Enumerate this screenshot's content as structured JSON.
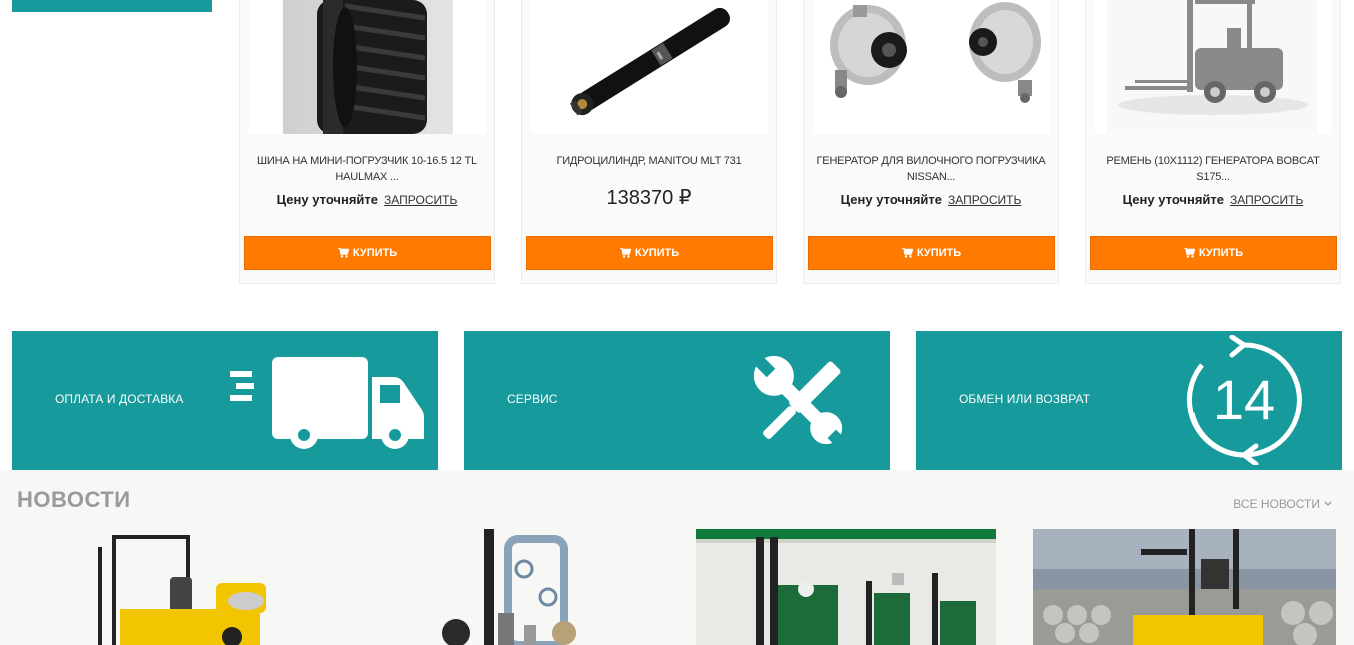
{
  "products": [
    {
      "title": "ШИНА НА МИНИ-ПОГРУЗЧИК 10-16.5 12 TL HAULMAX ...",
      "price_label": "Цену уточняйте",
      "ask_label": "ЗАПРОСИТЬ",
      "buy_label": "КУПИТЬ",
      "image": "tire"
    },
    {
      "title": "ГИДРОЦИЛИНДР, MANITOU MLT 731",
      "price": "138370 ₽",
      "buy_label": "КУПИТЬ",
      "image": "hydraulic-cylinder"
    },
    {
      "title": "ГЕНЕРАТОР ДЛЯ ВИЛОЧНОГО ПОГРУЗЧИКА NISSAN...",
      "price_label": "Цену уточняйте",
      "ask_label": "ЗАПРОСИТЬ",
      "buy_label": "КУПИТЬ",
      "image": "alternators"
    },
    {
      "title": "РЕМЕНЬ (10X1112) ГЕНЕРАТОРА BOBCAT S175...",
      "price_label": "Цену уточняйте",
      "ask_label": "ЗАПРОСИТЬ",
      "buy_label": "КУПИТЬ",
      "image": "forklift-placeholder"
    }
  ],
  "banners": [
    {
      "label": "ОПЛАТА И ДОСТАВКА",
      "icon": "truck-icon"
    },
    {
      "label": "СЕРВИС",
      "icon": "tools-icon"
    },
    {
      "label": "ОБМЕН ИЛИ ВОЗВРАТ",
      "icon": "return-14-icon",
      "icon_text": "14"
    }
  ],
  "news": {
    "title": "НОВОСТИ",
    "all_label": "ВСЕ НОВОСТИ"
  },
  "colors": {
    "teal": "#179a9b",
    "orange": "#ff7a00"
  }
}
